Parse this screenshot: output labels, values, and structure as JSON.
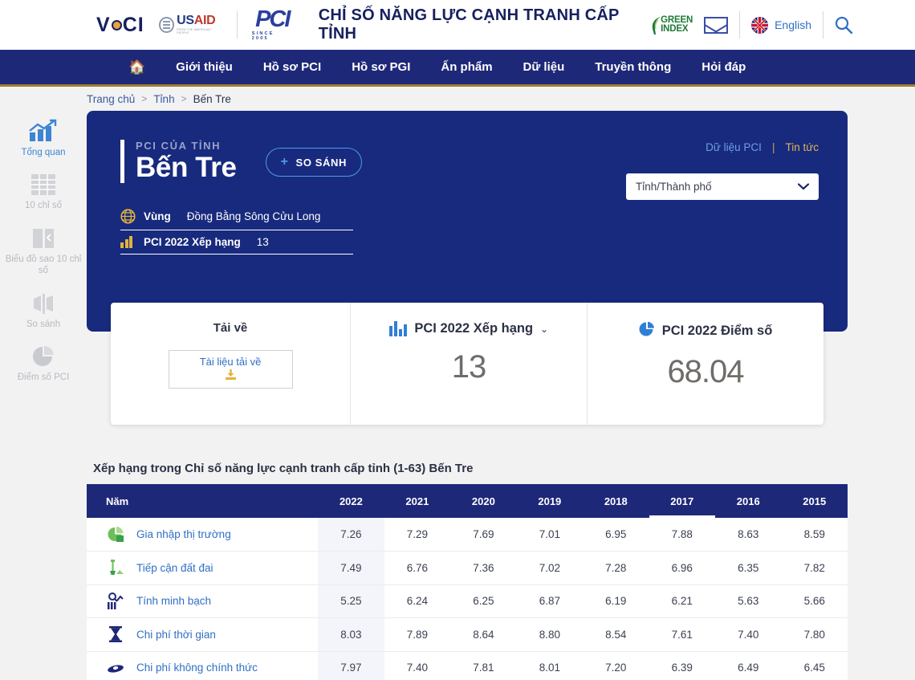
{
  "header": {
    "vcci_logo": "VCCI",
    "usaid_main": "USAID",
    "usaid_main_accent": "AID",
    "usaid_sub": "FROM THE AMERICAN PEOPLE",
    "pci_logo": "PCI",
    "pci_since": "SINCE 2005",
    "site_title": "CHỈ SỐ NĂNG LỰC CẠNH TRANH CẤP TỈNH",
    "green_index_line1": "GREEN",
    "green_index_line2": "INDEX",
    "mail_icon": "envelope-icon",
    "language": "English",
    "search_icon": "search-icon"
  },
  "nav": {
    "home_icon": "home-icon",
    "items": [
      {
        "label": "Giới thiệu"
      },
      {
        "label": "Hồ sơ PCI"
      },
      {
        "label": "Hồ sơ PGI"
      },
      {
        "label": "Ấn phẩm"
      },
      {
        "label": "Dữ liệu"
      },
      {
        "label": "Truyền thông"
      },
      {
        "label": "Hỏi đáp"
      }
    ]
  },
  "breadcrumb": {
    "home": "Trang chủ",
    "sep": ">",
    "level2": "Tỉnh",
    "current": "Bến Tre"
  },
  "sidebar": {
    "items": [
      {
        "label": "Tổng quan",
        "icon": "chart-growth-icon",
        "active": true
      },
      {
        "label": "10 chỉ số",
        "icon": "table-grid-icon",
        "active": false
      },
      {
        "label": "Biểu đồ sao 10 chỉ số",
        "icon": "radar-chart-icon",
        "active": false
      },
      {
        "label": "So sánh",
        "icon": "compare-icon",
        "active": false
      },
      {
        "label": "Điểm số PCI",
        "icon": "pie-chart-icon",
        "active": false
      }
    ]
  },
  "hero": {
    "eyebrow": "PCI CỦA TỈNH",
    "province": "Bến Tre",
    "compare_button": "SO SÁNH",
    "compare_plus": "+",
    "link_data": "Dữ liệu PCI",
    "link_sep": "|",
    "link_news": "Tin tức",
    "select_value": "Tỉnh/Thành phố",
    "region_label": "Vùng",
    "region_value": "Đồng Bằng Sông Cửu Long",
    "rank_label": "PCI 2022 Xếp hạng",
    "rank_value": "13"
  },
  "stats": {
    "download_title": "Tải về",
    "download_button": "Tài liệu tải về",
    "rank_title": "PCI 2022 Xếp hạng",
    "rank_value": "13",
    "score_title": "PCI 2022 Điểm số",
    "score_value": "68.04"
  },
  "table": {
    "title": "Xếp hạng trong Chỉ số năng lực cạnh tranh cấp tỉnh (1-63) Bến Tre",
    "name_header": "Năm",
    "years": [
      "2022",
      "2021",
      "2020",
      "2019",
      "2018",
      "2017",
      "2016",
      "2015"
    ],
    "highlight_year": "2017",
    "rows": [
      {
        "label": "Gia nhập thị trường",
        "icon": "pie-money-icon",
        "values": [
          "7.26",
          "7.29",
          "7.69",
          "7.01",
          "6.95",
          "7.88",
          "8.63",
          "8.59"
        ]
      },
      {
        "label": "Tiếp cận đất đai",
        "icon": "shovel-land-icon",
        "values": [
          "7.49",
          "6.76",
          "7.36",
          "7.02",
          "7.28",
          "6.96",
          "6.35",
          "7.82"
        ]
      },
      {
        "label": "Tính minh bạch",
        "icon": "magnifier-chart-icon",
        "values": [
          "5.25",
          "6.24",
          "6.25",
          "6.87",
          "6.19",
          "6.21",
          "5.63",
          "5.66"
        ]
      },
      {
        "label": "Chi phí thời gian",
        "icon": "hourglass-icon",
        "values": [
          "8.03",
          "7.89",
          "8.64",
          "8.80",
          "8.54",
          "7.61",
          "7.40",
          "7.80"
        ]
      },
      {
        "label": "Chi phí không chính thức",
        "icon": "money-stack-icon",
        "values": [
          "7.97",
          "7.40",
          "7.81",
          "8.01",
          "7.20",
          "6.39",
          "6.49",
          "6.45"
        ]
      }
    ]
  },
  "colors": {
    "navy": "#1e2878",
    "hero_navy": "#182a7e",
    "accent_blue": "#2f6fc4",
    "gold": "#d9b455",
    "green": "#1e7a36"
  }
}
